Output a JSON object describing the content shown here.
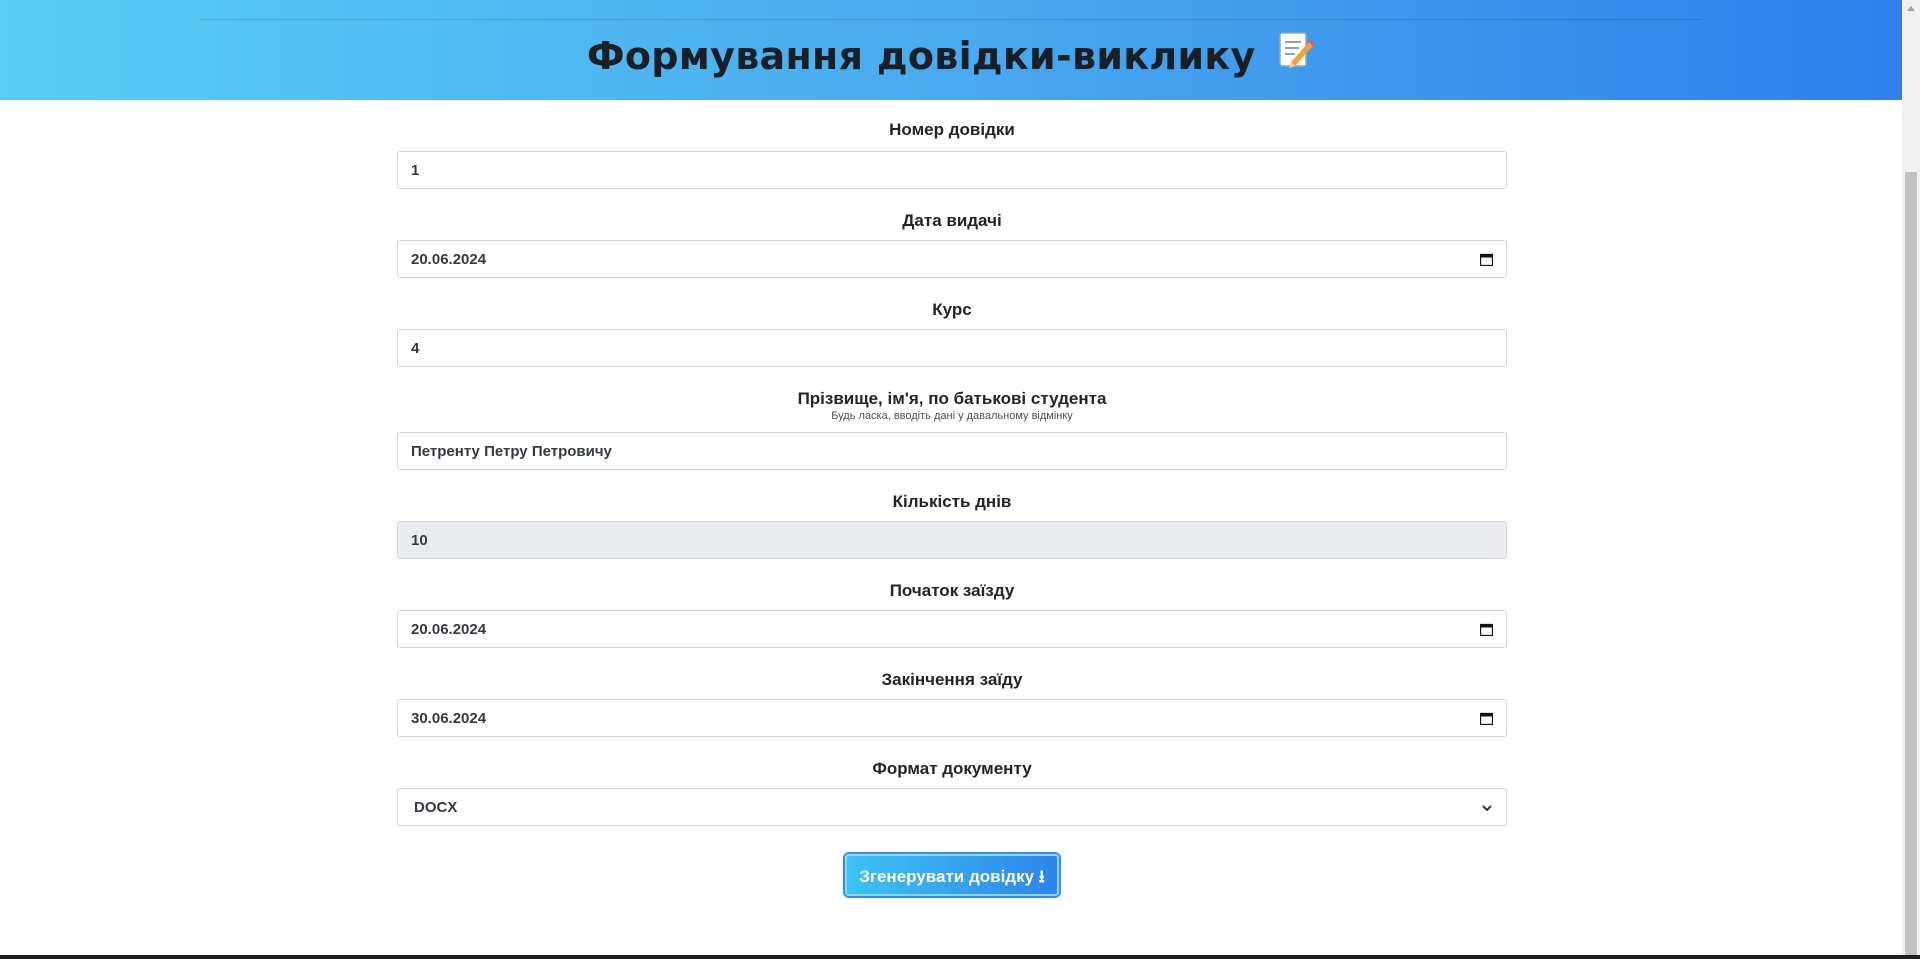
{
  "header": {
    "title": "Формування довідки-виклику"
  },
  "form": {
    "fields": [
      {
        "label": "Номер довідки",
        "value": "1"
      },
      {
        "label": "Дата видачі",
        "value": "20.06.2024"
      },
      {
        "label": "Курс",
        "value": "4"
      },
      {
        "label": "Прізвище, ім'я, по батькові студента",
        "hint": "Будь ласка, вводіть дані у давальному відмінку",
        "value": "Петренту Петру Петровичу"
      },
      {
        "label": "Кількість днів",
        "value": "10"
      },
      {
        "label": "Початок заїзду",
        "value": "20.06.2024"
      },
      {
        "label": "Закінчення заїду",
        "value": "30.06.2024"
      },
      {
        "label": "Формат документу",
        "value": "DOCX"
      }
    ],
    "submit_label": "Згенерувати довідку ⭳"
  },
  "icons": {
    "title": "memo-icon",
    "date": "calendar-icon",
    "select": "chevron-down-icon"
  },
  "colors": {
    "header_gradient_start": "#56cdf3",
    "header_gradient_end": "#2f80ec",
    "button_start": "#3cc3f3",
    "button_end": "#2d85ea",
    "disabled_field": "#e9ecef"
  }
}
